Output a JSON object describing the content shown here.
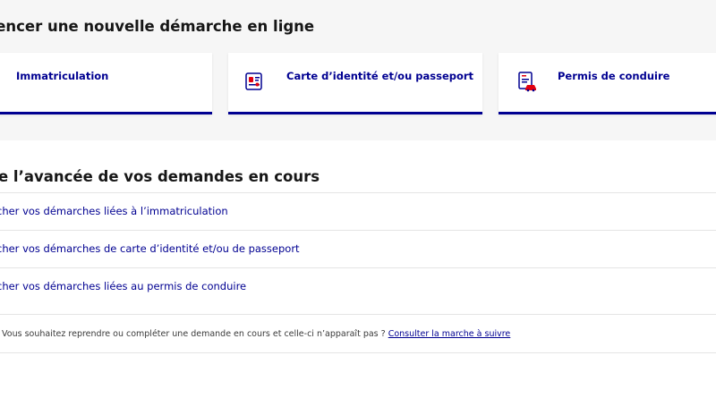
{
  "new_request": {
    "title": "mencer une nouvelle démarche en ligne",
    "cards": [
      {
        "label": "Immatriculation",
        "icon": "car-registration-icon"
      },
      {
        "label": "Carte d’identité et/ou passeport",
        "icon": "id-card-icon"
      },
      {
        "label": "Permis de conduire",
        "icon": "driving-license-icon"
      }
    ]
  },
  "track": {
    "title": "e l’avancée de vos demandes en cours",
    "links": [
      "cher vos démarches liées à l’immatriculation",
      "cher vos démarches de carte d’identité et/ou de passeport",
      "cher vos démarches liées au permis de conduire"
    ]
  },
  "info": {
    "text": "Vous souhaitez reprendre ou compléter une demande en cours et celle-ci n’apparaît pas ?",
    "link": "Consulter la marche à suivre"
  },
  "colors": {
    "accent": "#000091",
    "icon_red": "#e1000f",
    "background_gray": "#f6f6f6"
  }
}
